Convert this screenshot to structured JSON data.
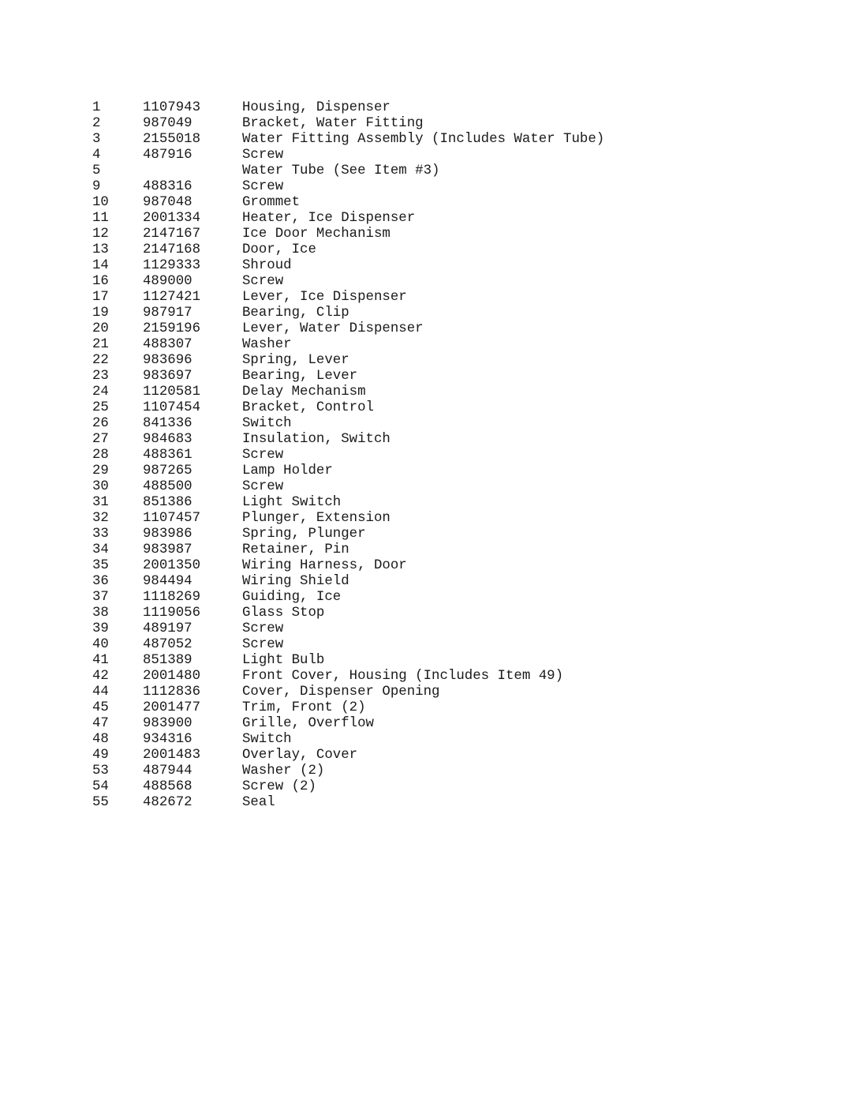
{
  "parts_list": {
    "rows": [
      {
        "item": "1",
        "part_number": "1107943",
        "description": "Housing, Dispenser"
      },
      {
        "item": "2",
        "part_number": "987049",
        "description": "Bracket, Water Fitting"
      },
      {
        "item": "3",
        "part_number": "2155018",
        "description": "Water Fitting Assembly (Includes Water Tube)"
      },
      {
        "item": "4",
        "part_number": "487916",
        "description": "Screw"
      },
      {
        "item": "5",
        "part_number": "",
        "description": "Water Tube (See Item #3)"
      },
      {
        "item": "9",
        "part_number": "488316",
        "description": "Screw"
      },
      {
        "item": "10",
        "part_number": "987048",
        "description": "Grommet"
      },
      {
        "item": "11",
        "part_number": "2001334",
        "description": "Heater, Ice Dispenser"
      },
      {
        "item": "12",
        "part_number": "2147167",
        "description": "Ice Door Mechanism"
      },
      {
        "item": "13",
        "part_number": "2147168",
        "description": "Door, Ice"
      },
      {
        "item": "14",
        "part_number": "1129333",
        "description": "Shroud"
      },
      {
        "item": "16",
        "part_number": "489000",
        "description": "Screw"
      },
      {
        "item": "17",
        "part_number": "1127421",
        "description": "Lever, Ice Dispenser"
      },
      {
        "item": "19",
        "part_number": "987917",
        "description": "Bearing, Clip"
      },
      {
        "item": "20",
        "part_number": "2159196",
        "description": "Lever, Water Dispenser"
      },
      {
        "item": "21",
        "part_number": "488307",
        "description": "Washer"
      },
      {
        "item": "22",
        "part_number": "983696",
        "description": "Spring, Lever"
      },
      {
        "item": "23",
        "part_number": "983697",
        "description": "Bearing, Lever"
      },
      {
        "item": "24",
        "part_number": "1120581",
        "description": "Delay Mechanism"
      },
      {
        "item": "25",
        "part_number": "1107454",
        "description": "Bracket, Control"
      },
      {
        "item": "26",
        "part_number": "841336",
        "description": "Switch"
      },
      {
        "item": "27",
        "part_number": "984683",
        "description": "Insulation, Switch"
      },
      {
        "item": "28",
        "part_number": "488361",
        "description": "Screw"
      },
      {
        "item": "29",
        "part_number": "987265",
        "description": "Lamp Holder"
      },
      {
        "item": "30",
        "part_number": "488500",
        "description": "Screw"
      },
      {
        "item": "31",
        "part_number": "851386",
        "description": "Light Switch"
      },
      {
        "item": "32",
        "part_number": "1107457",
        "description": "Plunger, Extension"
      },
      {
        "item": "33",
        "part_number": "983986",
        "description": "Spring, Plunger"
      },
      {
        "item": "34",
        "part_number": "983987",
        "description": "Retainer, Pin"
      },
      {
        "item": "35",
        "part_number": "2001350",
        "description": "Wiring Harness, Door"
      },
      {
        "item": "36",
        "part_number": "984494",
        "description": "Wiring Shield"
      },
      {
        "item": "37",
        "part_number": "1118269",
        "description": "Guiding, Ice"
      },
      {
        "item": "38",
        "part_number": "1119056",
        "description": "Glass Stop"
      },
      {
        "item": "39",
        "part_number": "489197",
        "description": "Screw"
      },
      {
        "item": "40",
        "part_number": "487052",
        "description": "Screw"
      },
      {
        "item": "41",
        "part_number": "851389",
        "description": "Light Bulb"
      },
      {
        "item": "42",
        "part_number": "2001480",
        "description": "Front Cover, Housing (Includes Item 49)"
      },
      {
        "item": "44",
        "part_number": "1112836",
        "description": "Cover, Dispenser Opening"
      },
      {
        "item": "45",
        "part_number": "2001477",
        "description": "Trim, Front (2)"
      },
      {
        "item": "47",
        "part_number": "983900",
        "description": "Grille, Overflow"
      },
      {
        "item": "48",
        "part_number": "934316",
        "description": "Switch"
      },
      {
        "item": "49",
        "part_number": "2001483",
        "description": "Overlay, Cover"
      },
      {
        "item": "53",
        "part_number": "487944",
        "description": "Washer (2)"
      },
      {
        "item": "54",
        "part_number": "488568",
        "description": "Screw (2)"
      },
      {
        "item": "55",
        "part_number": "482672",
        "description": "Seal"
      }
    ]
  }
}
